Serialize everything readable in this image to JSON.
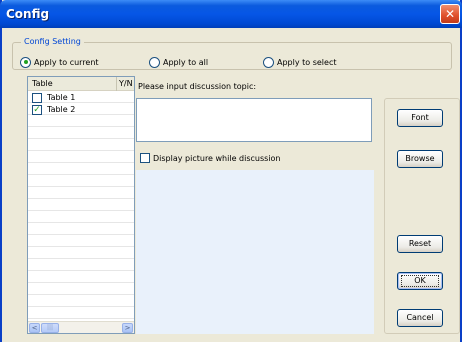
{
  "window": {
    "title": "Config",
    "close_label": "✕"
  },
  "config_setting": {
    "legend": "Config Setting",
    "options": [
      {
        "label": "Apply to current",
        "checked": true
      },
      {
        "label": "Apply to all",
        "checked": false
      },
      {
        "label": "Apply to select",
        "checked": false
      }
    ]
  },
  "table_list": {
    "columns": [
      "Table",
      "Y/N"
    ],
    "rows": [
      {
        "label": "Table 1",
        "checked": false
      },
      {
        "label": "Table 2",
        "checked": true
      }
    ],
    "scroll_left": "<",
    "scroll_right": ">",
    "scroll_grip": "|||"
  },
  "topic": {
    "prompt": "Please input discussion topic:",
    "value": ""
  },
  "display_picture": {
    "label": "Display picture while discussion",
    "checked": false
  },
  "buttons": {
    "font": "Font",
    "browse": "Browse",
    "reset": "Reset",
    "ok": "OK",
    "cancel": "Cancel"
  },
  "colors": {
    "title_bar": "#0656e6",
    "legend_text": "#0046d5",
    "picture_area": "#e9f1fb"
  }
}
